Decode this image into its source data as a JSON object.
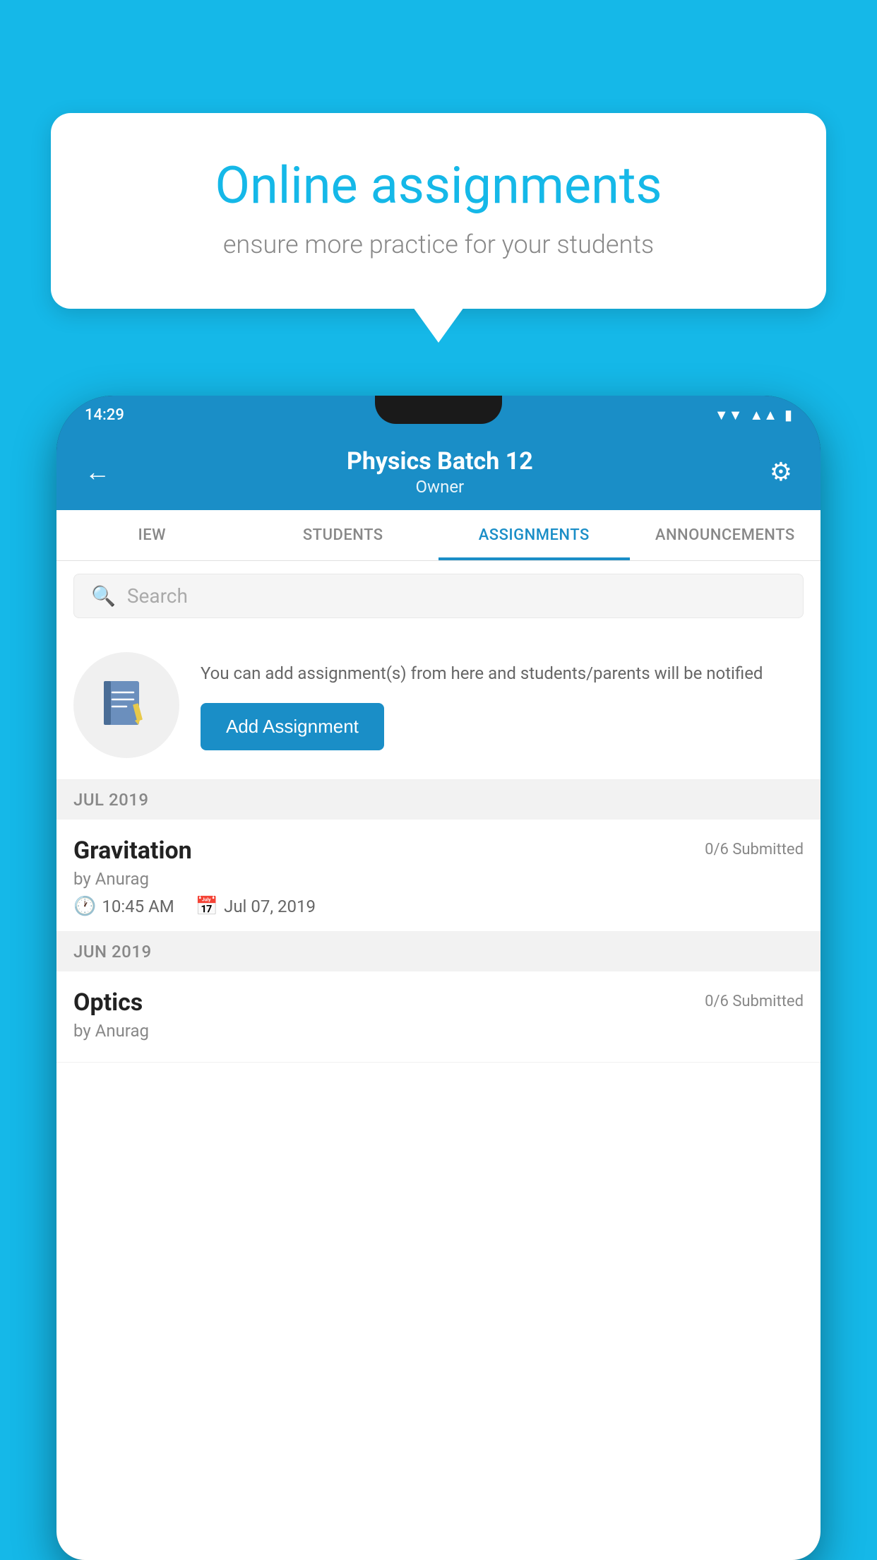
{
  "background_color": "#15b8e8",
  "info_card": {
    "title": "Online assignments",
    "subtitle": "ensure more practice for your students"
  },
  "status_bar": {
    "time": "14:29",
    "icons": {
      "wifi": "▼",
      "signal": "▲",
      "battery": "▮"
    }
  },
  "app_bar": {
    "back_icon": "←",
    "title": "Physics Batch 12",
    "subtitle": "Owner",
    "gear_icon": "⚙"
  },
  "tabs": [
    {
      "label": "IEW",
      "active": false
    },
    {
      "label": "STUDENTS",
      "active": false
    },
    {
      "label": "ASSIGNMENTS",
      "active": true
    },
    {
      "label": "ANNOUNCEMENTS",
      "active": false
    }
  ],
  "search": {
    "placeholder": "Search",
    "icon": "🔍"
  },
  "add_assignment_section": {
    "description": "You can add assignment(s) from here and students/parents will be notified",
    "button_label": "Add Assignment"
  },
  "sections": [
    {
      "month_label": "JUL 2019",
      "assignments": [
        {
          "name": "Gravitation",
          "submitted": "0/6 Submitted",
          "by": "by Anurag",
          "time": "10:45 AM",
          "date": "Jul 07, 2019"
        }
      ]
    },
    {
      "month_label": "JUN 2019",
      "assignments": [
        {
          "name": "Optics",
          "submitted": "0/6 Submitted",
          "by": "by Anurag",
          "time": "",
          "date": ""
        }
      ]
    }
  ]
}
